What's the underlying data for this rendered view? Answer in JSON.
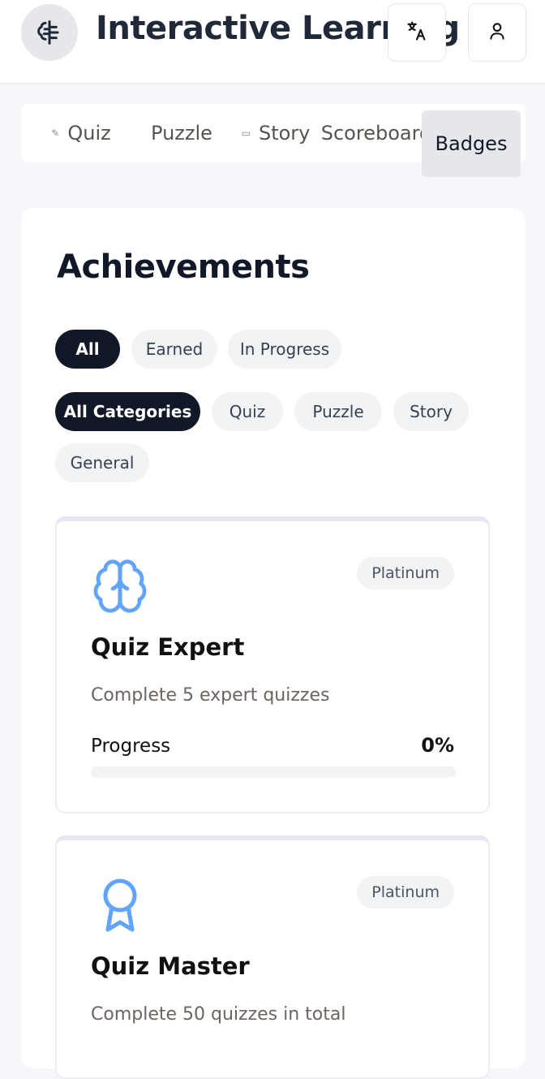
{
  "header": {
    "logo_icon": "brain-icon",
    "title": "Interactive Learning",
    "language_icon": "translate-icon",
    "user_icon": "user-icon"
  },
  "tabs": [
    {
      "label": "Quiz",
      "icon": "quiz-icon",
      "active": false
    },
    {
      "label": "Puzzle",
      "active": false
    },
    {
      "label": "Story",
      "icon": "story-icon",
      "active": false
    },
    {
      "label": "Scoreboard",
      "active": false
    },
    {
      "label": "Badges",
      "active": true
    }
  ],
  "achievements": {
    "title": "Achievements",
    "status_filters": [
      {
        "label": "All",
        "selected": true
      },
      {
        "label": "Earned",
        "selected": false
      },
      {
        "label": "In Progress",
        "selected": false
      }
    ],
    "category_filters": [
      {
        "label": "All Categories",
        "selected": true
      },
      {
        "label": "Quiz",
        "selected": false
      },
      {
        "label": "Puzzle",
        "selected": false
      },
      {
        "label": "Story",
        "selected": false
      },
      {
        "label": "General",
        "selected": false
      }
    ],
    "items": [
      {
        "icon": "brain-icon",
        "tier": "Platinum",
        "title": "Quiz Expert",
        "description": "Complete 5 expert quizzes",
        "progress_label": "Progress",
        "progress_value": "0%",
        "progress_fraction": 0
      },
      {
        "icon": "award-ribbon-icon",
        "tier": "Platinum",
        "title": "Quiz Master",
        "description": "Complete 50 quizzes in total"
      }
    ]
  },
  "colors": {
    "accent_blue": "#60a5fa",
    "chip_selected": "#111827",
    "chip_default": "#f1f3f5",
    "page_bg": "#f5f7fa"
  }
}
